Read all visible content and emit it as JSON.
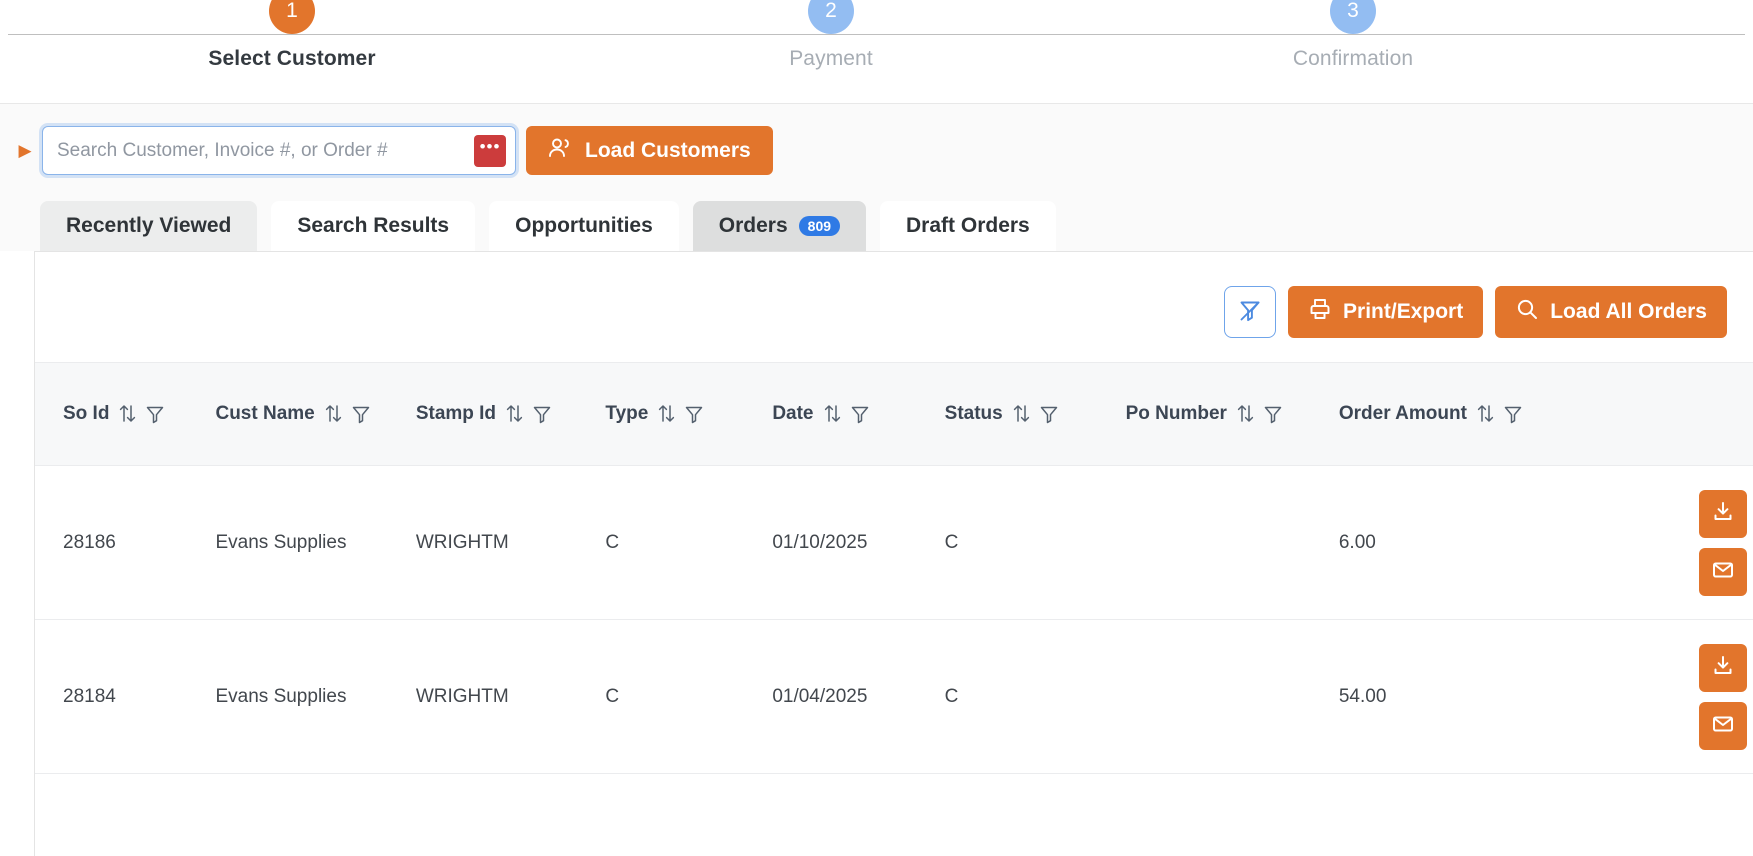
{
  "stepper": {
    "steps": [
      {
        "number": "1",
        "label": "Select Customer",
        "state": "active"
      },
      {
        "number": "2",
        "label": "Payment",
        "state": "idle"
      },
      {
        "number": "3",
        "label": "Confirmation",
        "state": "idle"
      }
    ]
  },
  "search": {
    "placeholder": "Search Customer, Invoice #, or Order #",
    "value": "",
    "dots_label": "•••",
    "load_customers_label": "Load Customers"
  },
  "tabs": [
    {
      "label": "Recently Viewed",
      "state": "muted",
      "badge": null
    },
    {
      "label": "Search Results",
      "state": "normal",
      "badge": null
    },
    {
      "label": "Opportunities",
      "state": "normal",
      "badge": null
    },
    {
      "label": "Orders",
      "state": "active",
      "badge": "809"
    },
    {
      "label": "Draft Orders",
      "state": "normal",
      "badge": null
    }
  ],
  "toolbar": {
    "clear_filter_label": "",
    "print_export_label": "Print/Export",
    "load_all_orders_label": "Load All Orders"
  },
  "table": {
    "columns": [
      {
        "key": "so_id",
        "label": "So Id"
      },
      {
        "key": "cust_name",
        "label": "Cust Name"
      },
      {
        "key": "stamp_id",
        "label": "Stamp Id"
      },
      {
        "key": "type",
        "label": "Type"
      },
      {
        "key": "date",
        "label": "Date"
      },
      {
        "key": "status",
        "label": "Status"
      },
      {
        "key": "po_number",
        "label": "Po Number"
      },
      {
        "key": "order_amount",
        "label": "Order Amount"
      }
    ],
    "rows": [
      {
        "so_id": "28186",
        "cust_name": "Evans Supplies",
        "stamp_id": "WRIGHTM",
        "type": "C",
        "date": "01/10/2025",
        "status": "C",
        "po_number": "",
        "order_amount": "6.00"
      },
      {
        "so_id": "28184",
        "cust_name": "Evans Supplies",
        "stamp_id": "WRIGHTM",
        "type": "C",
        "date": "01/04/2025",
        "status": "C",
        "po_number": "",
        "order_amount": "54.00"
      }
    ]
  },
  "colors": {
    "accent_orange": "#e2752c",
    "step_idle_blue": "#93bdf2",
    "badge_blue": "#2f7ae5",
    "dots_red": "#cc3c3c",
    "outline_blue": "#6fa4ea"
  }
}
